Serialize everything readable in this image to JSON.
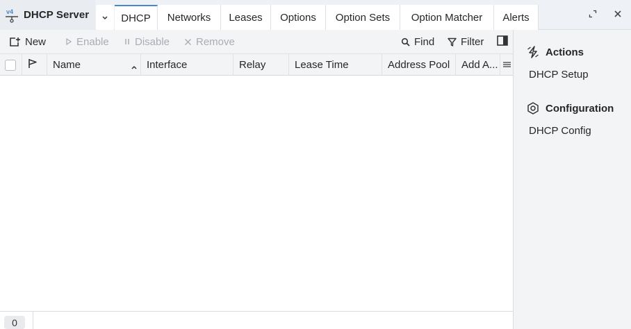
{
  "app": {
    "title": "DHCP Server"
  },
  "tabs": [
    {
      "label": "DHCP",
      "active": true
    },
    {
      "label": "Networks",
      "active": false
    },
    {
      "label": "Leases",
      "active": false
    },
    {
      "label": "Options",
      "active": false
    },
    {
      "label": "Option Sets",
      "active": false
    },
    {
      "label": "Option Matcher",
      "active": false
    },
    {
      "label": "Alerts",
      "active": false
    }
  ],
  "toolbar": {
    "new_label": "New",
    "enable_label": "Enable",
    "disable_label": "Disable",
    "remove_label": "Remove",
    "find_label": "Find",
    "filter_label": "Filter"
  },
  "table": {
    "columns": [
      "Name",
      "Interface",
      "Relay",
      "Lease Time",
      "Address Pool",
      "Add A..."
    ],
    "sort_column": "Name",
    "rows": []
  },
  "footer": {
    "count": "0"
  },
  "sidepanel": {
    "actions_heading": "Actions",
    "actions_items": [
      "DHCP Setup"
    ],
    "config_heading": "Configuration",
    "config_items": [
      "DHCP Config"
    ]
  },
  "colors": {
    "accent": "#4a87c8",
    "panel_bg": "#f3f4f6",
    "disabled_text": "#a9adb3"
  }
}
